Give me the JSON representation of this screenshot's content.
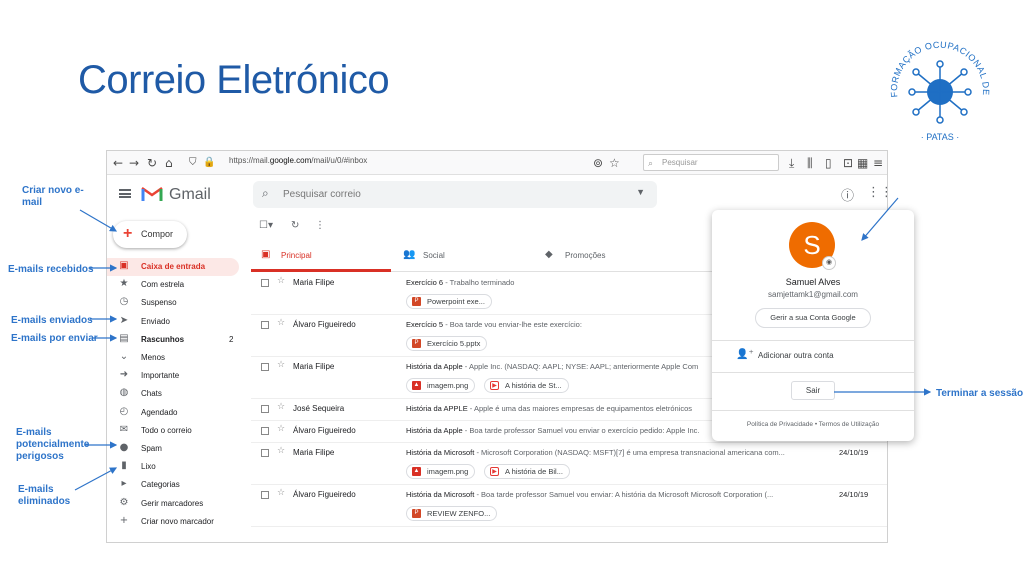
{
  "slide": {
    "title": "Correio Eletrónico",
    "logo_text": "FORMAÇÃO OCUPACIONAL DE SENIORES · PATAS ·"
  },
  "browser": {
    "url_prefix": "https://mail.",
    "url_domain": "google.com",
    "url_path": "/mail/u/0/#inbox",
    "search_placeholder": "Pesquisar"
  },
  "gmail": {
    "logo_text": "Gmail",
    "search_placeholder": "Pesquisar correio",
    "avatar_letter": "S",
    "compose_label": "Compor",
    "sidebar": [
      {
        "icon": "inbox-icon",
        "glyph": "▣",
        "label": "Caixa de entrada",
        "count": "",
        "active": true
      },
      {
        "icon": "star-icon",
        "glyph": "★",
        "label": "Com estrela",
        "count": ""
      },
      {
        "icon": "clock-icon",
        "glyph": "◷",
        "label": "Suspenso",
        "count": ""
      },
      {
        "icon": "send-icon",
        "glyph": "➤",
        "label": "Enviado",
        "count": ""
      },
      {
        "icon": "draft-icon",
        "glyph": "▤",
        "label": "Rascunhos",
        "count": "2",
        "bold": true
      },
      {
        "icon": "chevron-down-icon",
        "glyph": "⌄",
        "label": "Menos",
        "count": ""
      },
      {
        "icon": "important-icon",
        "glyph": "➜",
        "label": "Importante",
        "count": ""
      },
      {
        "icon": "chat-icon",
        "glyph": "◍",
        "label": "Chats",
        "count": ""
      },
      {
        "icon": "scheduled-icon",
        "glyph": "◴",
        "label": "Agendado",
        "count": ""
      },
      {
        "icon": "all-mail-icon",
        "glyph": "✉",
        "label": "Todo o correio",
        "count": ""
      },
      {
        "icon": "spam-icon",
        "glyph": "●",
        "label": "Spam",
        "count": ""
      },
      {
        "icon": "trash-icon",
        "glyph": "▮",
        "label": "Lixo",
        "count": ""
      },
      {
        "icon": "label-icon",
        "glyph": "▸",
        "label": "Categorias",
        "count": ""
      },
      {
        "icon": "gear-icon",
        "glyph": "⚙",
        "label": "Gerir marcadores",
        "count": ""
      },
      {
        "icon": "plus-icon",
        "glyph": "+",
        "label": "Criar novo marcador",
        "count": ""
      }
    ],
    "tabs": [
      {
        "icon": "inbox-icon",
        "glyph": "▣",
        "label": "Principal",
        "active": true
      },
      {
        "icon": "people-icon",
        "glyph": "👥",
        "label": "Social"
      },
      {
        "icon": "tag-icon",
        "glyph": "◆",
        "label": "Promoções"
      }
    ],
    "emails": [
      {
        "sender": "Maria Filipe",
        "subject": "Exercício 6",
        "snippet": " - Trabalho terminado",
        "date": "",
        "attachments": [
          {
            "type": "ppt",
            "label": "Powerpoint exe..."
          }
        ]
      },
      {
        "sender": "Álvaro Figueiredo",
        "subject": "Exercício 5",
        "snippet": " - Boa tarde vou enviar-lhe este exercício:",
        "date": "",
        "attachments": [
          {
            "type": "ppt",
            "label": "Exercício 5.pptx"
          }
        ]
      },
      {
        "sender": "Maria Filipe",
        "subject": "História da Apple",
        "snippet": " - Apple Inc. (NASDAQ: AAPL; NYSE: AAPL; anteriormente Apple Com",
        "date": "",
        "attachments": [
          {
            "type": "img",
            "label": "imagem.png"
          },
          {
            "type": "yt",
            "label": "A história de St..."
          }
        ]
      },
      {
        "sender": "José Sequeira",
        "subject": "História da APPLE",
        "snippet": " - Apple é uma das maiores empresas de equipamentos eletrónicos",
        "date": "",
        "attachments": []
      },
      {
        "sender": "Álvaro Figueiredo",
        "subject": "História da Apple",
        "snippet": " - Boa tarde professor Samuel vou enviar o exercício pedido: Apple Inc.",
        "date": "",
        "attachments": []
      },
      {
        "sender": "Maria Filipe",
        "subject": "História da Microsoft",
        "snippet": " - Microsoft Corporation (NASDAQ: MSFT)[7] é uma empresa transnacional americana com...",
        "date": "24/10/19",
        "attachments": [
          {
            "type": "img",
            "label": "imagem.png"
          },
          {
            "type": "yt",
            "label": "A história de Bil..."
          }
        ]
      },
      {
        "sender": "Álvaro Figueiredo",
        "subject": "História da Microsoft",
        "snippet": " - Boa tarde professor Samuel vou enviar: A história da Microsoft Microsoft Corporation (...",
        "date": "24/10/19",
        "attachments": [
          {
            "type": "ppt",
            "label": "REVIEW ZENFO..."
          }
        ]
      }
    ],
    "account_popup": {
      "avatar_letter": "S",
      "name": "Samuel Alves",
      "email": "samjettamk1@gmail.com",
      "manage_label": "Gerir a sua Conta Google",
      "add_account_label": "Adicionar outra conta",
      "signout_label": "Sair",
      "footer": "Política de Privacidade  •  Termos de Utilização"
    }
  },
  "annotations": {
    "compose": "Criar novo e-mail",
    "inbox": "E-mails recebidos",
    "sent": "E-mails enviados",
    "drafts": "E-mails por enviar",
    "spam": "E-mails potencialmente perigosos",
    "trash": "E-mails eliminados",
    "signout": "Terminar a sessão"
  },
  "colors": {
    "accent_blue": "#1f5aa6",
    "annotation_blue": "#2e74c9",
    "gmail_red": "#d93025",
    "avatar_orange": "#ef6c00"
  }
}
